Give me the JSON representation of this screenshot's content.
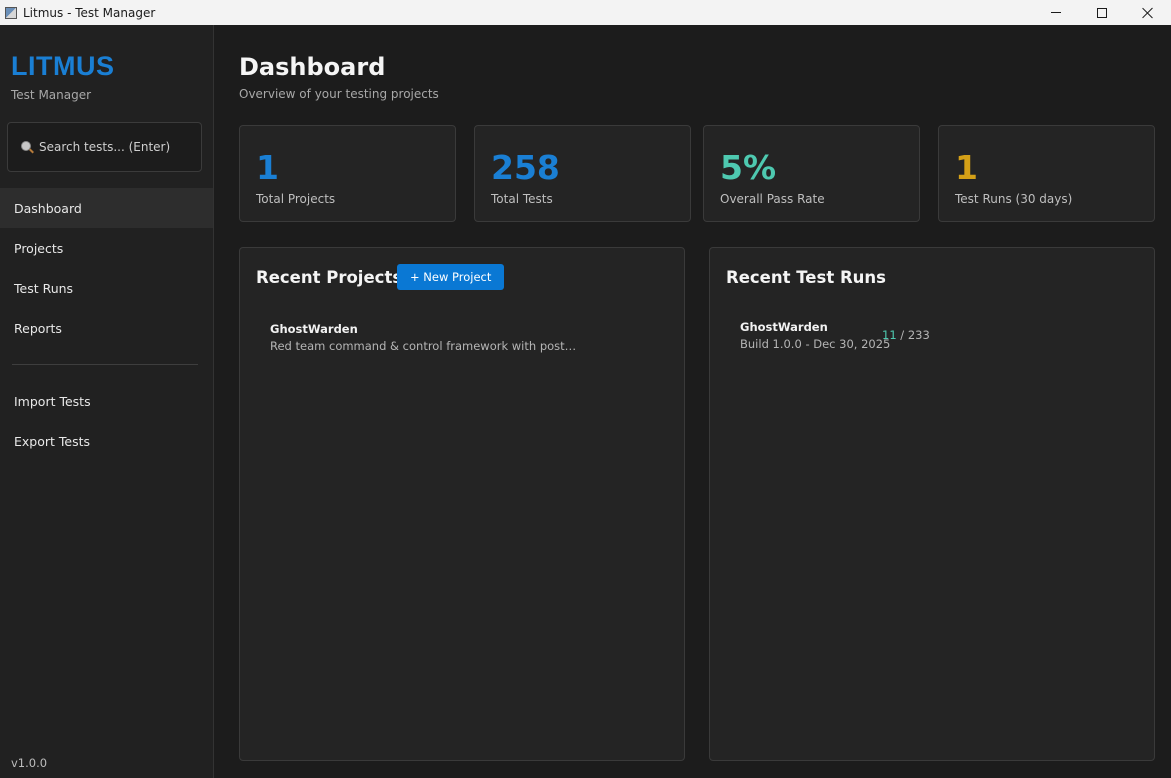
{
  "window": {
    "title": "Litmus - Test Manager"
  },
  "sidebar": {
    "brand": "LITMUS",
    "brand_subtitle": "Test Manager",
    "search_placeholder": "Search tests... (Enter)",
    "nav": [
      {
        "label": "Dashboard",
        "active": true
      },
      {
        "label": "Projects"
      },
      {
        "label": "Test Runs"
      },
      {
        "label": "Reports"
      }
    ],
    "tools": [
      {
        "label": "Import Tests"
      },
      {
        "label": "Export Tests"
      }
    ],
    "version": "v1.0.0"
  },
  "page": {
    "title": "Dashboard",
    "subtitle": "Overview of your testing projects"
  },
  "stats": [
    {
      "value": "1",
      "label": "Total Projects",
      "color": "#1a7fd4"
    },
    {
      "value": "258",
      "label": "Total Tests",
      "color": "#1a7fd4"
    },
    {
      "value": "5%",
      "label": "Overall Pass Rate",
      "color": "#4ec9b0"
    },
    {
      "value": "1",
      "label": "Test Runs (30 days)",
      "color": "#d4a017"
    }
  ],
  "recent_projects": {
    "title": "Recent Projects",
    "new_button": "+ New Project",
    "items": [
      {
        "name": "GhostWarden",
        "description": "Red team command & control framework with post-quantum cryptography"
      }
    ]
  },
  "recent_runs": {
    "title": "Recent Test Runs",
    "items": [
      {
        "name": "GhostWarden",
        "meta": "Build 1.0.0  -  Dec 30, 2025",
        "passed": "11",
        "separator": " / ",
        "total": "233"
      }
    ]
  },
  "colors": {
    "accent": "#0a78d4",
    "pass": "#4ec9b0",
    "warning": "#d4a017",
    "background": "#1c1c1c",
    "panel": "#242424"
  }
}
